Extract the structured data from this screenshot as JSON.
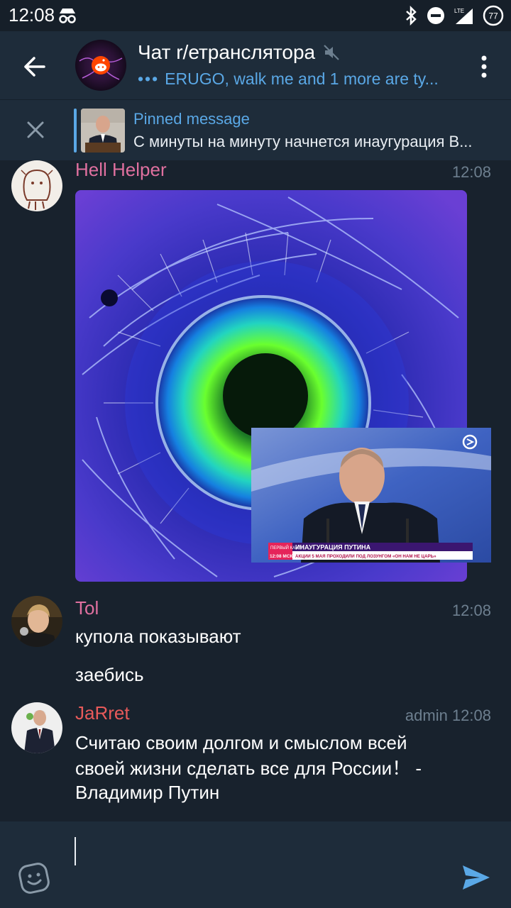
{
  "status_bar": {
    "time": "12:08",
    "battery_level": "77"
  },
  "header": {
    "title": "Чат r/етранслятора",
    "typing_dots": "•••",
    "subtitle": "ERUGO, walk me and 1 more are ty..."
  },
  "pinned": {
    "title": "Pinned message",
    "text": "С минуты на минуту начнется инаугурация В..."
  },
  "messages": [
    {
      "author": "Hell Helper",
      "time": "12:08",
      "name_color": "#e0709f"
    },
    {
      "author": "Tol",
      "time": "12:08",
      "name_color": "#e0709f",
      "lines": [
        "купола показывают",
        "заебись"
      ]
    },
    {
      "author": "JaRret",
      "badge_time": "admin 12:08",
      "name_color": "#e85a5a",
      "text_lines": [
        "Считаю своим долгом и смыслом всей",
        "своей жизни сделать все для России！ -",
        "Владимир Путин"
      ]
    }
  ],
  "pip_video": {
    "channel": "ПЕРВЫЙ КАНАЛ",
    "headline": "ИНАУГУРАЦИЯ ПУТИНА",
    "clock": "12:08 МСК",
    "ticker": "АКЦИИ 5 МАЯ ПРОХОДИЛИ ПОД ЛОЗУНГОМ «ОН НАМ НЕ ЦАРЬ»"
  },
  "input": {
    "placeholder": ""
  },
  "colors": {
    "background": "#18222d",
    "header": "#1e2c3a",
    "accent": "#5aa8e6"
  },
  "icons": [
    "back-arrow-icon",
    "mute-icon",
    "more-vertical-icon",
    "close-icon",
    "emoji-icon",
    "send-icon",
    "incognito-icon",
    "bluetooth-icon",
    "dnd-icon",
    "signal-icon",
    "battery-icon"
  ]
}
